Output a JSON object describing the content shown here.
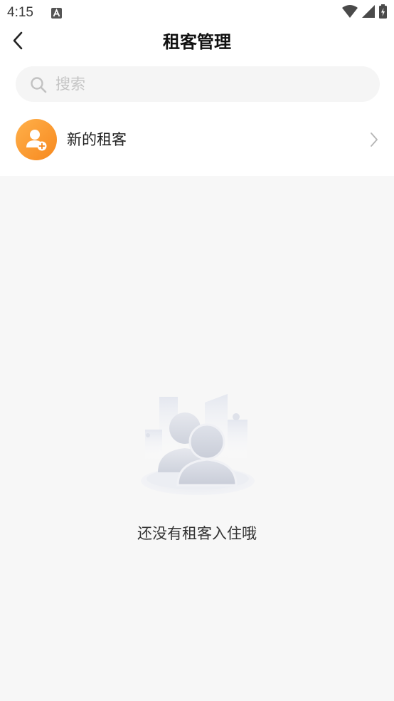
{
  "status_bar": {
    "time": "4:15",
    "notification_icon": "a-notification-icon",
    "wifi_icon": "wifi-icon",
    "signal_icon": "cell-signal-icon",
    "battery_icon": "battery-charging-icon"
  },
  "header": {
    "back_icon": "chevron-left-icon",
    "title": "租客管理"
  },
  "search": {
    "icon": "search-icon",
    "placeholder": "搜索",
    "value": ""
  },
  "new_tenant": {
    "icon": "add-user-icon",
    "label": "新的租客",
    "chevron": "chevron-right-icon"
  },
  "empty_state": {
    "illustration": "empty-tenants-illustration",
    "message": "还没有租客入住哦"
  },
  "colors": {
    "accent_orange": "#f7891f",
    "page_background": "#f7f7f7",
    "search_background": "#f5f5f5",
    "placeholder": "#c4c4c4"
  }
}
